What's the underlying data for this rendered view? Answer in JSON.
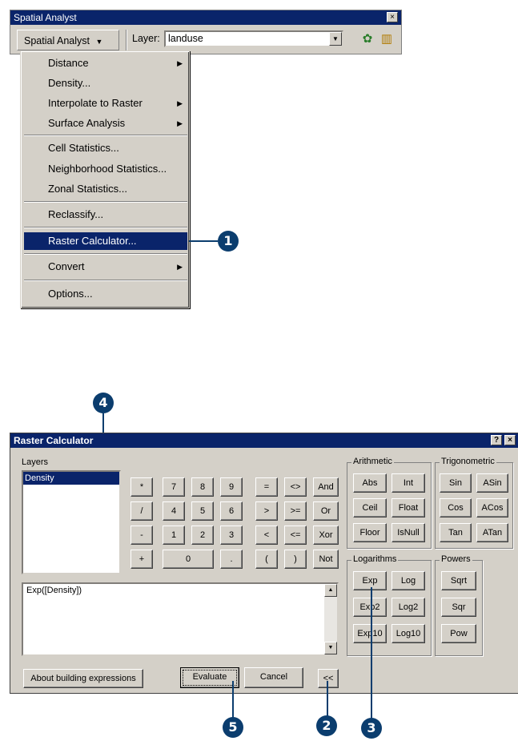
{
  "toolbar": {
    "title": "Spatial Analyst",
    "close_glyph": "×",
    "menu_button": "Spatial Analyst",
    "menu_arrow": "▼",
    "layer_label": "Layer:",
    "layer_value": "landuse",
    "combo_arrow": "▼",
    "icon_1": "✿",
    "icon_2": "▥"
  },
  "menu": {
    "items": [
      {
        "label": "Distance",
        "submenu": "▶"
      },
      {
        "label": "Density..."
      },
      {
        "label": "Interpolate to Raster",
        "submenu": "▶"
      },
      {
        "label": "Surface Analysis",
        "submenu": "▶"
      },
      {
        "label": "Cell Statistics..."
      },
      {
        "label": "Neighborhood Statistics..."
      },
      {
        "label": "Zonal Statistics..."
      },
      {
        "label": "Reclassify..."
      },
      {
        "label": "Raster Calculator..."
      },
      {
        "label": "Convert",
        "submenu": "▶"
      },
      {
        "label": "Options..."
      }
    ]
  },
  "callouts": [
    "1",
    "4",
    "5",
    "2",
    "3"
  ],
  "dialog": {
    "title": "Raster Calculator",
    "help_glyph": "?",
    "close_glyph": "×",
    "layers_label": "Layers",
    "layers": [
      "Density"
    ],
    "ops": [
      "*",
      "/",
      "-",
      "+"
    ],
    "nums": [
      "7",
      "8",
      "9",
      "4",
      "5",
      "6",
      "1",
      "2",
      "3",
      "0",
      "."
    ],
    "compare": [
      "=",
      "<>",
      ">",
      ">=",
      "<",
      "<=",
      "(",
      ")"
    ],
    "logic": [
      "And",
      "Or",
      "Xor",
      "Not"
    ],
    "arithmetic_label": "Arithmetic",
    "arithmetic": [
      "Abs",
      "Int",
      "Ceil",
      "Float",
      "Floor",
      "IsNull"
    ],
    "trig_label": "Trigonometric",
    "trig": [
      "Sin",
      "ASin",
      "Cos",
      "ACos",
      "Tan",
      "ATan"
    ],
    "log_label": "Logarithms",
    "logs": [
      "Exp",
      "Log",
      "Exp2",
      "Log2",
      "Exp10",
      "Log10"
    ],
    "powers_label": "Powers",
    "powers": [
      "Sqrt",
      "Sqr",
      "Pow"
    ],
    "expression": "Exp([Density])",
    "about_button": "About building expressions",
    "evaluate_button": "Evaluate",
    "cancel_button": "Cancel",
    "collapse_button": "<<",
    "scroll_up": "▲",
    "scroll_down": "▼"
  }
}
